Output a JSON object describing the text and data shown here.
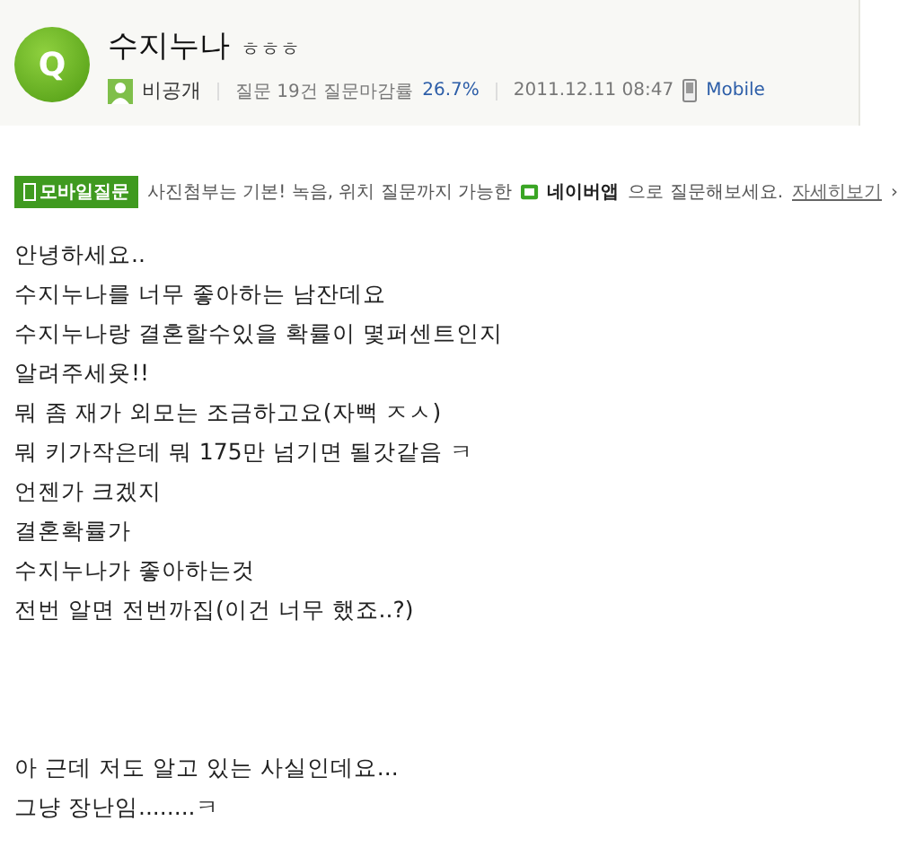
{
  "question": {
    "badge": "Q",
    "title": "수지누나",
    "title_suffix": "ㅎㅎㅎ",
    "author": "비공개",
    "stats": "질문 19건 질문마감률",
    "rate": "26.7%",
    "date": "2011.12.11 08:47",
    "source": "Mobile"
  },
  "banner": {
    "tag": "모바일질문",
    "text": "사진첨부는 기본! 녹음, 위치 질문까지 가능한",
    "app": "네이버앱",
    "text_after": "으로 질문해보세요.",
    "link": "자세히보기",
    "link_arrow": "›"
  },
  "body": [
    {
      "lines": [
        "안녕하세요..",
        "수지누나를 너무 좋아하는 남잔데요",
        "수지누나랑 결혼할수있을 확률이 몇퍼센트인지",
        "알려주세욧!!",
        "뭐 좀 재가 외모는 조금하고요(자뻑 ㅈㅅ)",
        "뭐 키가작은데 뭐 175만 넘기면 될갓같음 ㅋ",
        "언젠가 크겠지",
        "결혼확률가",
        "수지누나가 좋아하는것",
        "전번 알면 전번까집(이건 너무 했죠..?)"
      ]
    },
    {
      "lines": [
        "아 근데 저도 알고 있는 사실인데요...",
        "그냥 장난임........ㅋ"
      ]
    }
  ]
}
